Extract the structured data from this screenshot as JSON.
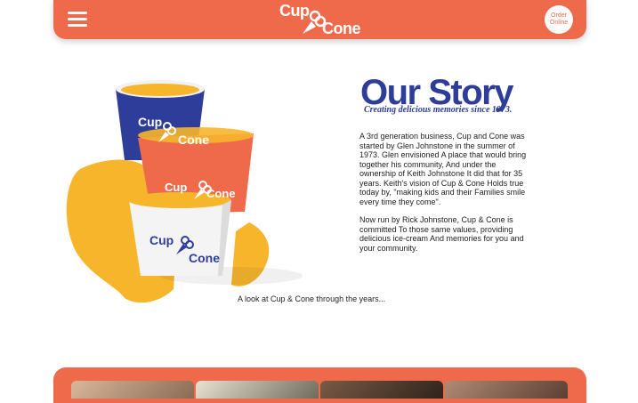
{
  "header": {
    "logo_top": "Cup",
    "logo_bottom": "Cone",
    "order_line1": "Order",
    "order_line2": "Online"
  },
  "product": {
    "cup_top_text1": "Cup",
    "cup_top_text2": "Cone",
    "cup_mid_text1": "Cup",
    "cup_mid_text2": "Cone",
    "cup_bottom_text1": "Cup",
    "cup_bottom_text2": "Cone"
  },
  "story": {
    "title": "Our Story",
    "subtitle": "Creating delicious memories since 1973.",
    "paragraph1": "A 3rd generation business, Cup and Cone was started by Glen Johnstone in the summer of 1973. Glen envisioned A place that would bring together his community, And under the ownership of Keith Johnstone It did that for 35 years. Keith's vision of Cup & Cone Holds true today by, \"making kids and their Families smile every time they come\".",
    "paragraph2": "Now run by Rick Johnstone, Cup & Cone is committed To those same values, providing delicious ice-cream And memories for you and your community."
  },
  "gallery": {
    "caption": "A look at Cup & Cone through the years..."
  },
  "colors": {
    "brand_orange": "#ef6a4b",
    "brand_blue": "#2e3d9a",
    "brand_yellow": "#f7b52c"
  }
}
